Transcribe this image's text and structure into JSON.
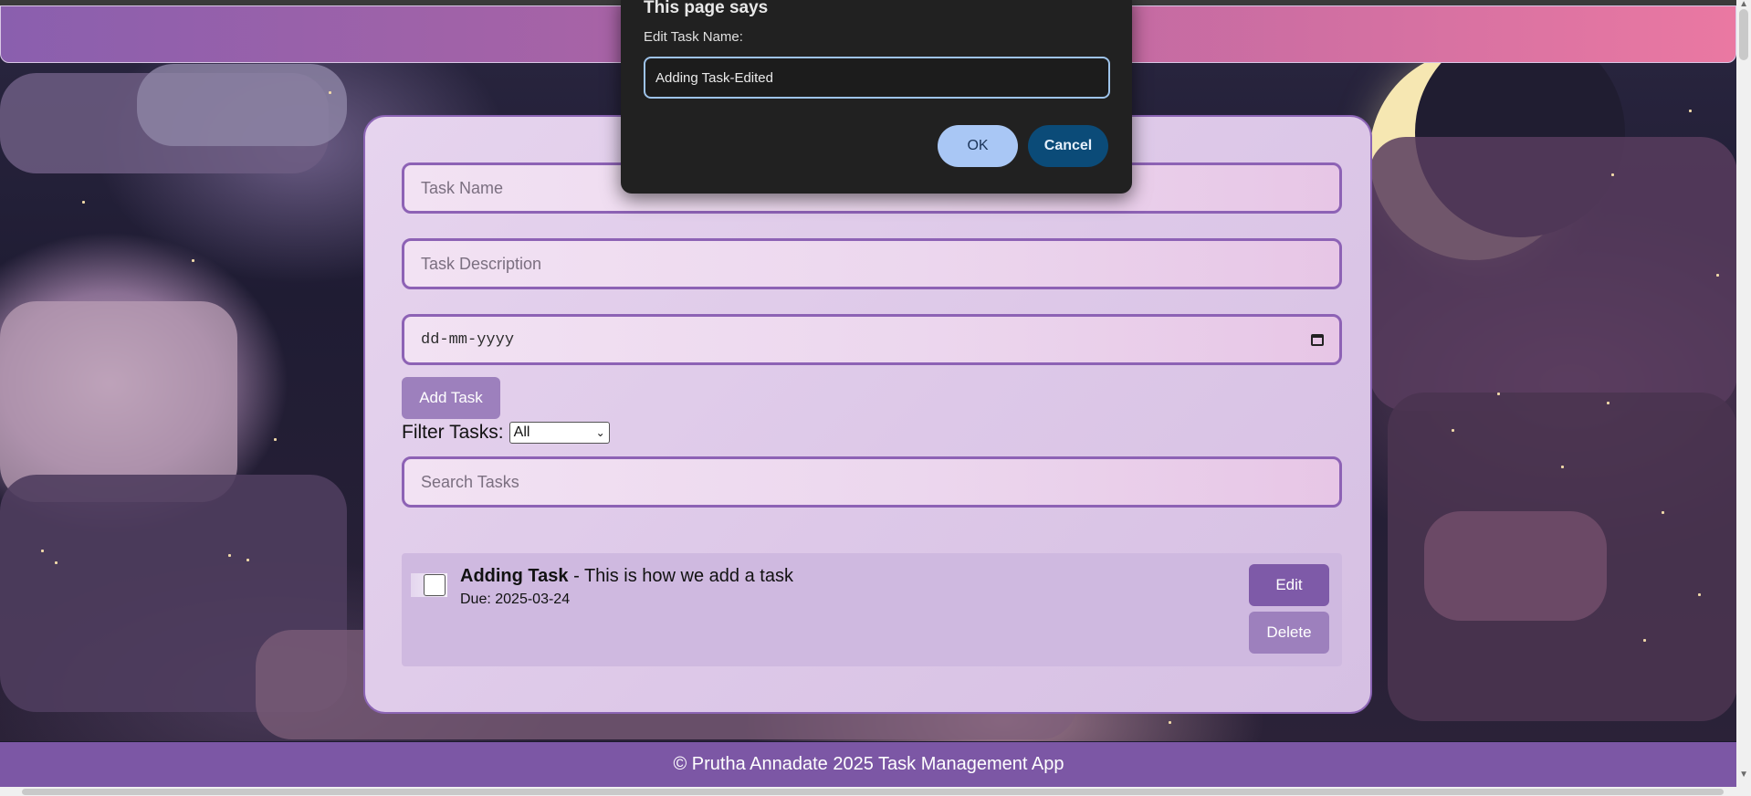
{
  "dialog": {
    "title": "This page says",
    "label": "Edit Task Name:",
    "input_value": "Adding Task-Edited",
    "ok_label": "OK",
    "cancel_label": "Cancel"
  },
  "form": {
    "task_name_placeholder": "Task Name",
    "task_description_placeholder": "Task Description",
    "date_placeholder": "dd-mm-yyyy",
    "add_button_label": "Add Task",
    "filter_label": "Filter Tasks:",
    "filter_selected": "All",
    "search_placeholder": "Search Tasks"
  },
  "tasks": [
    {
      "name": "Adding Task",
      "separator": " - ",
      "description": "This is how we add a task",
      "due": "Due: 2025-03-24",
      "edit_label": "Edit",
      "delete_label": "Delete"
    }
  ],
  "footer": {
    "text": "© Prutha Annadate 2025 Task Management App"
  },
  "colors": {
    "primary": "#7e5aa8",
    "header_gradient_start": "#8a5fae",
    "header_gradient_end": "#ea78a2",
    "dialog_bg": "#212121",
    "ok_button": "#a9c7f5",
    "cancel_button": "#0b4b78"
  },
  "icons": {
    "date_picker": "calendar-icon",
    "select_arrow": "chevron-down-icon"
  }
}
